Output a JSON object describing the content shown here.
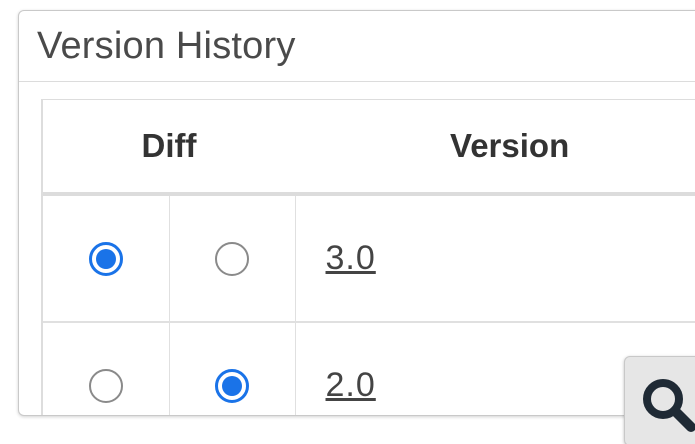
{
  "panel": {
    "title": "Version History"
  },
  "table": {
    "headers": {
      "diff": "Diff",
      "version": "Version"
    },
    "rows": [
      {
        "left_selected": true,
        "right_selected": false,
        "version": "3.0"
      },
      {
        "left_selected": false,
        "right_selected": true,
        "version": "2.0"
      }
    ]
  },
  "colors": {
    "accent": "#1a73e8",
    "title_text": "#4a4a4a",
    "link_text": "#444444"
  },
  "icons": {
    "search": "search-icon"
  }
}
